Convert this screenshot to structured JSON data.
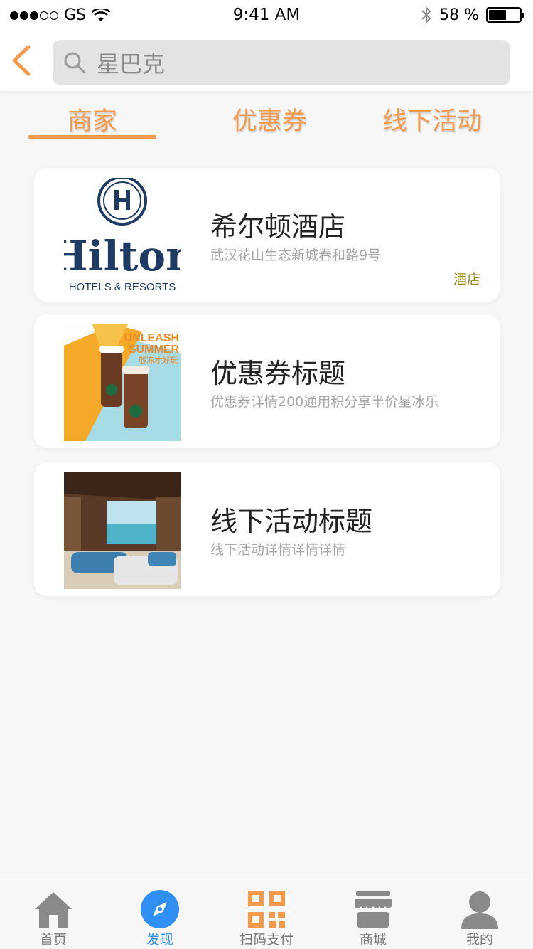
{
  "status_bar": {
    "carrier": "GS",
    "time": "9:41 AM",
    "battery": "58 %",
    "battery_level": 0.58
  },
  "search": {
    "query": "星巴克"
  },
  "tabs": [
    {
      "label": "商家",
      "active": true
    },
    {
      "label": "优惠券",
      "active": false
    },
    {
      "label": "线下活动",
      "active": false
    }
  ],
  "cards": [
    {
      "title": "希尔顿酒店",
      "subtitle": "武汉花山生态新城春和路9号",
      "tag": "酒店",
      "logo_text": "Hilton",
      "logo_sub": "HOTELS & RESORTS"
    },
    {
      "title": "优惠券标题",
      "subtitle": "优惠券详情200通用积分享半价星冰乐",
      "image_text_1": "UNLEASH",
      "image_text_2": "SUMMER",
      "image_text_3": "够冻才好玩"
    },
    {
      "title": "线下活动标题",
      "subtitle": "线下活动详情详情详情"
    }
  ],
  "nav": [
    {
      "label": "首页",
      "icon": "home-icon",
      "active": false
    },
    {
      "label": "发现",
      "icon": "compass-icon",
      "active": true
    },
    {
      "label": "扫码支付",
      "icon": "qr-code-icon",
      "active": false
    },
    {
      "label": "商城",
      "icon": "store-icon",
      "active": false
    },
    {
      "label": "我的",
      "icon": "user-icon",
      "active": false
    }
  ],
  "colors": {
    "accent": "#f59a4a",
    "nav_active": "#2f8ff2",
    "tag": "#9a8a1a"
  }
}
